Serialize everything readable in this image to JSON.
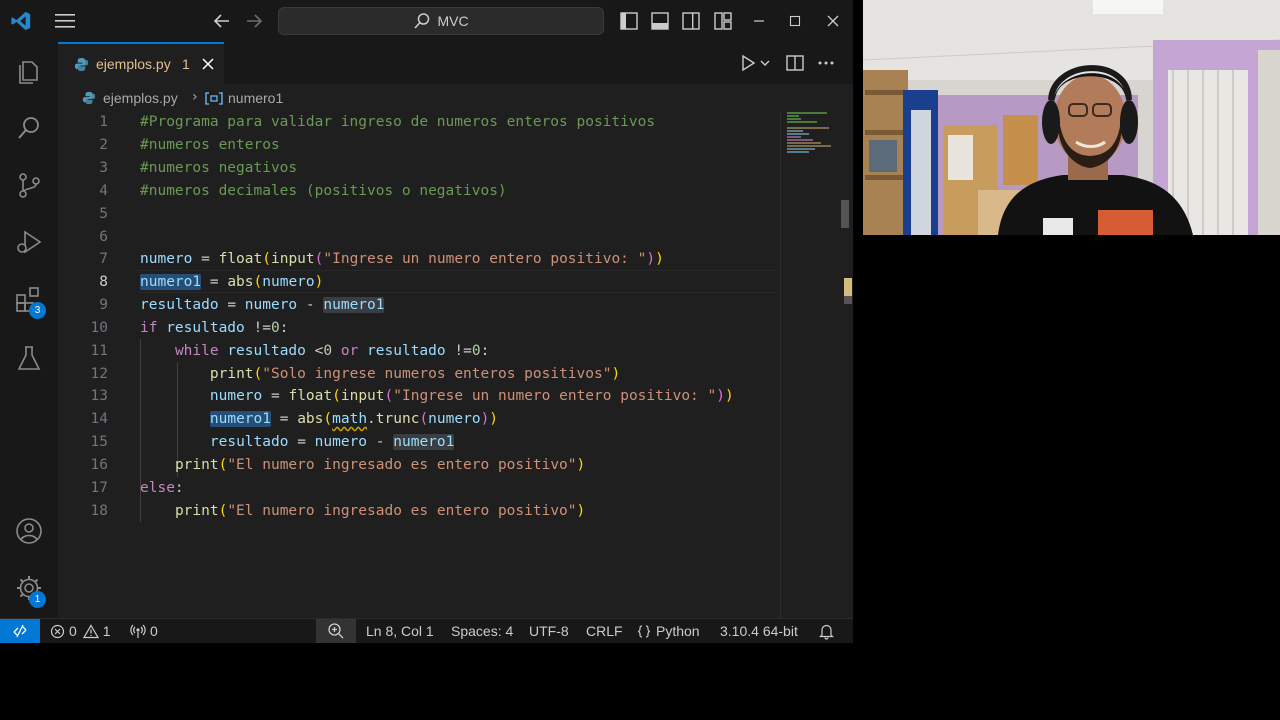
{
  "titlebar": {
    "search_text": "MVC",
    "icons": [
      "vscode-logo-icon",
      "menu-icon",
      "arrow-left-icon",
      "arrow-right-icon",
      "search-icon",
      "toggle-sidebar-icon",
      "toggle-panel-icon",
      "toggle-secondary-sidebar-icon",
      "customize-layout-icon",
      "minimize-icon",
      "maximize-icon",
      "close-icon"
    ]
  },
  "activity_bar": {
    "items": [
      {
        "name": "explorer",
        "icon": "files-icon"
      },
      {
        "name": "search",
        "icon": "search-icon"
      },
      {
        "name": "source-control",
        "icon": "source-control-icon"
      },
      {
        "name": "run-debug",
        "icon": "run-debug-icon"
      },
      {
        "name": "extensions",
        "icon": "extensions-icon",
        "badge": "3"
      },
      {
        "name": "testing",
        "icon": "flask-icon"
      }
    ],
    "bottom": [
      {
        "name": "accounts",
        "icon": "account-icon"
      },
      {
        "name": "manage",
        "icon": "gear-icon",
        "badge": "1"
      }
    ]
  },
  "tab": {
    "filename": "ejemplos.py",
    "problem_count": "1"
  },
  "breadcrumb": {
    "file": "ejemplos.py",
    "symbol": "numero1"
  },
  "editor": {
    "active_line": "8",
    "line_numbers": [
      "1",
      "2",
      "3",
      "4",
      "5",
      "6",
      "7",
      "8",
      "9",
      "10",
      "11",
      "12",
      "13",
      "14",
      "15",
      "16",
      "17",
      "18"
    ],
    "lines": [
      "#Programa para validar ingreso de numeros enteros positivos",
      "#numeros enteros",
      "#numeros negativos",
      "#numeros decimales (positivos o negativos)",
      "",
      "",
      "numero = float(input(\"Ingrese un numero entero positivo: \"))",
      "numero1 = abs(numero)",
      "resultado = numero - numero1",
      "if resultado !=0:",
      "    while resultado <0 or resultado !=0:",
      "        print(\"Solo ingrese numeros enteros positivos\")",
      "        numero = float(input(\"Ingrese un numero entero positivo: \"))",
      "        numero1 = abs(math.trunc(numero))",
      "        resultado = numero - numero1",
      "    print(\"El numero ingresado es entero positivo\")",
      "else:",
      "    print(\"El numero ingresado es entero positivo\")"
    ]
  },
  "statusbar": {
    "errors": "0",
    "warnings": "1",
    "ports": "0",
    "cursor": "Ln 8, Col 1",
    "spaces": "Spaces: 4",
    "encoding": "UTF-8",
    "eol": "CRLF",
    "language": "Python",
    "interpreter": "3.10.4 64-bit"
  },
  "colors": {
    "accent": "#0078d4",
    "comment": "#6a9955",
    "string": "#ce9178",
    "keyword": "#c586c0",
    "variable": "#9cdcfe",
    "function": "#dcdcaa",
    "modified_tab": "#e2c08d"
  }
}
